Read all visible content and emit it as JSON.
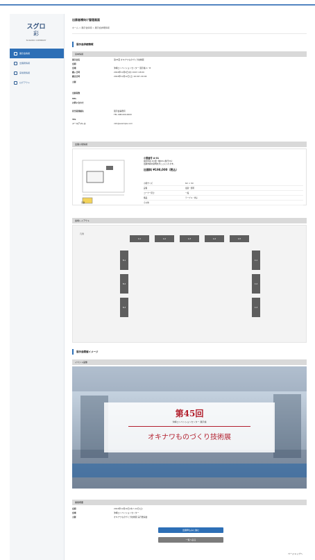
{
  "sidebar": {
    "logo": {
      "line1": "スグロ",
      "line2": "彩",
      "tagline": "SUGURO COMPANY"
    },
    "items": [
      {
        "label": "展示会情報",
        "active": true
      },
      {
        "label": "出展者情報",
        "active": false
      },
      {
        "label": "来場者情報",
        "active": false
      },
      {
        "label": "ログアウト",
        "active": false
      }
    ]
  },
  "header": {
    "title": "出展者様向け管理画面",
    "breadcrumb": "ホーム > 展示会情報 > 展示会詳細情報"
  },
  "section1": {
    "title": "展示会詳細情報",
    "info_head": "基本情報",
    "rows": [
      {
        "k": "展示会名",
        "v": "第45回 オキナワものづくり技術展"
      },
      {
        "k": "会期",
        "v": ""
      },
      {
        "k": "会場",
        "v": "沖縄コンベンションセンター 展示棟 A・B"
      },
      {
        "k": "搬入日時",
        "v": "2024年10月9日(水) 9:00〜18:00"
      },
      {
        "k": "搬出日時",
        "v": "2024年10月12日(土) 16:00〜20:00"
      },
      {
        "k": "主催",
        "v": ""
      },
      {
        "k": "",
        "v": ""
      },
      {
        "k": "出展者数",
        "v": ""
      },
      {
        "k": "URL",
        "v": ""
      },
      {
        "k": "お問い合わせ",
        "v": ""
      },
      {
        "k": "担当者連絡先",
        "v": "展示会事務局"
      },
      {
        "k": "",
        "v": "TEL 098-000-0000"
      },
      {
        "k": "TEL",
        "v": ""
      },
      {
        "k": "メールアドレス",
        "v": "info@example.com"
      }
    ]
  },
  "booth": {
    "head": "出展小間情報",
    "name": "小間番号 A-01",
    "type": "展示区画 2小間（幅6m×奥行3m）",
    "desc": "出展内容の説明文がここに入ります。",
    "price": "出展料 ¥198,000（税込）",
    "table": [
      {
        "k": "小間サイズ",
        "v": "6m × 3m"
      },
      {
        "k": "設備",
        "v": "電源・照明"
      },
      {
        "k": "コーナー区分",
        "v": "一般"
      },
      {
        "k": "備品",
        "v": "テーブル・椅子"
      },
      {
        "k": "その他",
        "v": ""
      }
    ],
    "legend": "凡例"
  },
  "layout": {
    "head": "会場レイアウト",
    "legend_label": "凡例",
    "top_booths": [
      "A-1",
      "A-2",
      "A-3",
      "A-4",
      "A-5"
    ],
    "left_booths": [
      "B-1",
      "B-2",
      "B-3"
    ],
    "right_booths": [
      "C-1",
      "C-2",
      "C-3"
    ]
  },
  "section2": {
    "title": "展示会開催イメージ",
    "head": "イベント画像"
  },
  "photo": {
    "title": "第45回",
    "sub": "沖縄コンベンションセンター 展示棟",
    "big": "オキナワものづくり技術展",
    "accent": "#b21f2d"
  },
  "outline": {
    "head": "開催概要",
    "rows": [
      {
        "k": "会期",
        "v": "2024年10月10日(木)〜12日(土)"
      },
      {
        "k": "会場",
        "v": "沖縄コンベンションセンター"
      },
      {
        "k": "主催",
        "v": "オキナワものづくり技術展 実行委員会"
      }
    ]
  },
  "buttons": {
    "primary": "出展申込みに進む",
    "secondary": "一覧へ戻る",
    "pagetop": "ページトップへ"
  },
  "colors": {
    "primary": "#2d6fb6",
    "sidebar_bg": "#f4f6f8",
    "booth_gray": "#5e5e5e",
    "accent": "#b21f2d"
  }
}
